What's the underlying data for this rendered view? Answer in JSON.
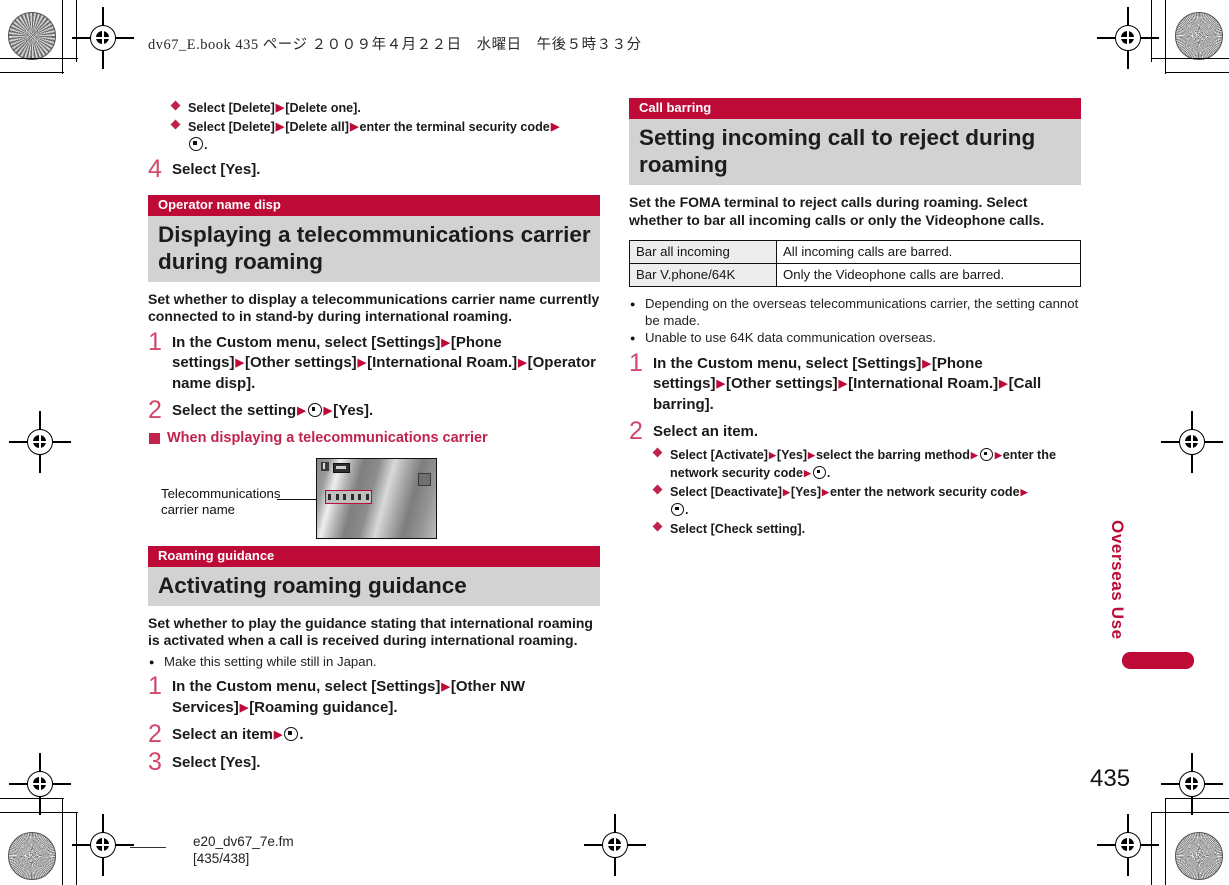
{
  "page": {
    "book_header": "dv67_E.book  435 ページ  ２００９年４月２２日　水曜日　午後５時３３分",
    "footer_file": "e20_dv67_7e.fm",
    "footer_range": "[435/438]",
    "side_tab": "Overseas Use",
    "page_number": "435",
    "accent_color": "#BE0A36",
    "band_color": "#D2D2D2",
    "step_number_color": "#D1486B"
  },
  "left_column": {
    "carryover_bullets": [
      {
        "text_a": "Select [Delete]",
        "text_b": "[Delete one].",
        "has_key": false
      },
      {
        "text_a": "Select [Delete]",
        "text_b": "[Delete all]",
        "text_c": "enter the terminal security code",
        "has_key": true
      }
    ],
    "step4": {
      "num": "4",
      "text": "Select [Yes]."
    },
    "section_operator": {
      "kicker": "Operator name disp",
      "title": "Displaying a telecommunications carrier during roaming",
      "lede": "Set whether to display a telecommunications carrier name currently connected to in stand-by during international roaming.",
      "steps": [
        {
          "num": "1",
          "p1": "In the Custom menu, select [Settings]",
          "p2": "[Phone settings]",
          "p3": "[Other settings]",
          "p4": "[International Roam.]",
          "p5": "[Operator name disp]."
        },
        {
          "num": "2",
          "p1": "Select the setting",
          "p2": "[Yes]."
        }
      ],
      "subheading": "When displaying a telecommunications carrier",
      "figure": {
        "label_line1": "Telecommunications",
        "label_line2": "carrier name"
      }
    },
    "section_roaming": {
      "kicker": "Roaming guidance",
      "title": "Activating roaming guidance",
      "lede": "Set whether to play the guidance stating that international roaming is activated when a call is received during international roaming.",
      "notes": [
        "Make this setting while still in Japan."
      ],
      "steps": [
        {
          "num": "1",
          "p1": "In the Custom menu, select [Settings]",
          "p2": "[Other NW Services]",
          "p3": "[Roaming guidance]."
        },
        {
          "num": "2",
          "p1": "Select an item",
          "p2": "."
        },
        {
          "num": "3",
          "p1": "Select [Yes]."
        }
      ]
    }
  },
  "right_column": {
    "section_call_barring": {
      "kicker": "Call barring",
      "title": "Setting incoming call to reject during roaming",
      "lede": "Set the FOMA terminal to reject calls during roaming. Select whether to bar all incoming calls or only the Videophone calls.",
      "table": {
        "rows": [
          {
            "key": "Bar all incoming",
            "value": "All incoming calls are barred."
          },
          {
            "key": "Bar V.phone/64K",
            "value": "Only the Videophone calls are barred."
          }
        ]
      },
      "notes": [
        "Depending on the overseas telecommunications carrier, the setting cannot be made.",
        "Unable to use 64K data communication overseas."
      ],
      "steps": [
        {
          "num": "1",
          "p1": "In the Custom menu, select [Settings]",
          "p2": "[Phone settings]",
          "p3": "[Other settings]",
          "p4": "[International Roam.]",
          "p5": "[Call barring]."
        },
        {
          "num": "2",
          "p1": "Select an item."
        }
      ],
      "sub_bullets": [
        {
          "a": "Select [Activate]",
          "b": "[Yes]",
          "c": "select the barring method",
          "d": "enter the network security code"
        },
        {
          "a": "Select [Deactivate]",
          "b": "[Yes]",
          "c": "enter the network security code"
        },
        {
          "a": "Select [Check setting]."
        }
      ]
    }
  }
}
